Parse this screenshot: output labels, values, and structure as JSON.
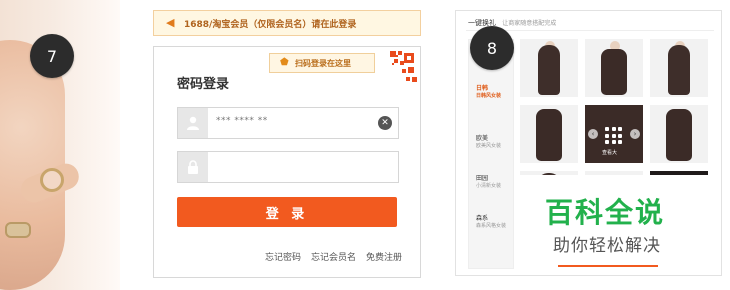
{
  "steps": {
    "left": "7",
    "right": "8"
  },
  "login": {
    "notice": "1688/淘宝会员（仅限会员名）请在此登录",
    "qr_hint": "扫码登录在这里",
    "title": "密码登录",
    "username_value": "*** **** **",
    "password_value": "",
    "submit_label": "登 录",
    "links": [
      "忘记密码",
      "忘记会员名",
      "免费注册"
    ]
  },
  "shop": {
    "header_title": "一键换礼",
    "header_sub": "让商家随意搭配完成",
    "side_items": [
      {
        "label": "日韩",
        "sub": "日韩风女装",
        "active": true
      },
      {
        "label": "欧美",
        "sub": "欧美风女装",
        "active": false
      },
      {
        "label": "田园",
        "sub": "小清新女装",
        "active": false
      },
      {
        "label": "森系",
        "sub": "森系风格女装",
        "active": false
      }
    ],
    "overlay_label": "查看大"
  },
  "watermark": {
    "title": "百科全说",
    "subtitle": "助你轻松解决"
  },
  "colors": {
    "accent": "#f25a1f",
    "badge": "#2c2c2c",
    "watermark_green": "#22b14c"
  }
}
